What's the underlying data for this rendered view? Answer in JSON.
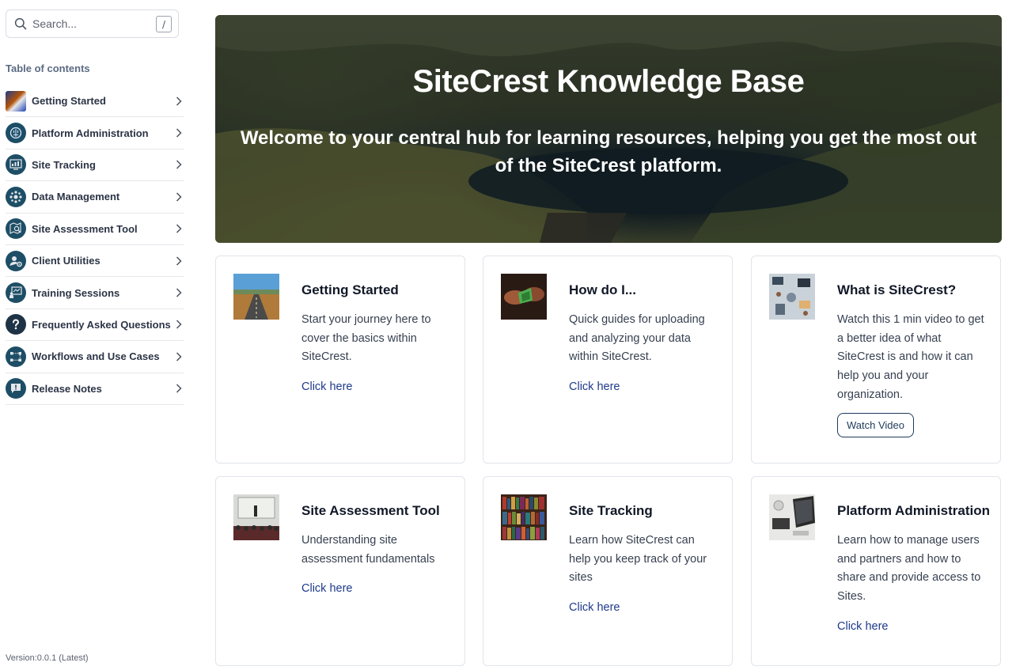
{
  "search": {
    "placeholder": "Search...",
    "shortcut": "/"
  },
  "sidebar": {
    "toc_title": "Table of contents",
    "items": [
      {
        "label": "Getting Started",
        "icon": "getting-started-image-icon"
      },
      {
        "label": "Platform Administration",
        "icon": "brain-icon"
      },
      {
        "label": "Site Tracking",
        "icon": "dashboard-icon"
      },
      {
        "label": "Data Management",
        "icon": "network-icon"
      },
      {
        "label": "Site Assessment Tool",
        "icon": "map-search-icon"
      },
      {
        "label": "Client Utilities",
        "icon": "user-gear-icon"
      },
      {
        "label": "Training Sessions",
        "icon": "presentation-icon"
      },
      {
        "label": "Frequently Asked Questions",
        "icon": "question-icon"
      },
      {
        "label": "Workflows and Use Cases",
        "icon": "workflow-icon"
      },
      {
        "label": "Release Notes",
        "icon": "notes-icon"
      }
    ],
    "version": "Version:0.0.1 (Latest)"
  },
  "hero": {
    "title": "SiteCrest Knowledge Base",
    "subtitle": "Welcome to your central hub for learning resources, helping you get the most out of the SiteCrest platform."
  },
  "cards": [
    {
      "title": "Getting Started",
      "description": "Start your journey here to cover the basics within SiteCrest.",
      "link": "Click here"
    },
    {
      "title": "How do I...",
      "description": "Quick guides for uploading and analyzing your data within SiteCrest.",
      "link": "Click here"
    },
    {
      "title": "What is SiteCrest?",
      "description": "Watch this 1 min video to get a better idea of what SiteCrest is and how it can help you and your organization.",
      "button": "Watch Video"
    },
    {
      "title": "Site Assessment Tool",
      "description": "Understanding site assessment fundamentals",
      "link": "Click here"
    },
    {
      "title": "Site Tracking",
      "description": "Learn how SiteCrest can help you keep track of your sites",
      "link": "Click here"
    },
    {
      "title": "Platform Administration",
      "description": "Learn how to manage users and partners and how to share and provide access to Sites.",
      "link": "Click here"
    }
  ],
  "colors": {
    "accent": "#1e3a8a",
    "icon_bg": "#1d4e66",
    "text": "#2b3445"
  }
}
